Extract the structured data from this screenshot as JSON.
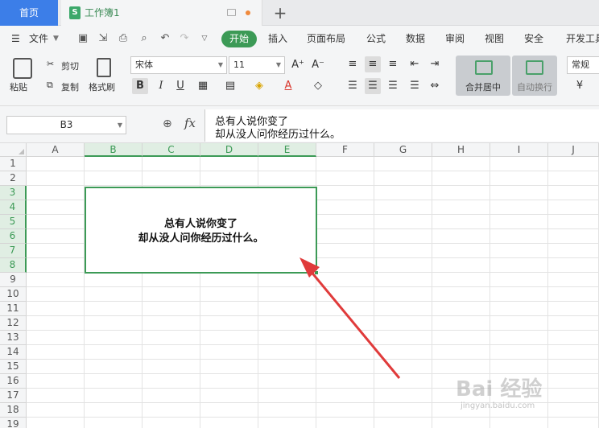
{
  "tabs": {
    "home": "首页",
    "document": "工作簿1",
    "doc_icon_letter": "S",
    "add": "+"
  },
  "menu": {
    "file": "文件",
    "items": [
      "开始",
      "插入",
      "页面布局",
      "公式",
      "数据",
      "审阅",
      "视图",
      "安全",
      "开发工具"
    ]
  },
  "ribbon": {
    "paste": "粘贴",
    "cut": "剪切",
    "copy": "复制",
    "format_painter": "格式刷",
    "font_name": "宋体",
    "font_size": "11",
    "merge_center": "合并居中",
    "wrap_text": "自动换行",
    "number_format": "常规",
    "currency_symbol": "¥"
  },
  "formula_bar": {
    "name_box": "B3",
    "fx": "fx",
    "content_line1": "总有人说你变了",
    "content_line2": "却从没人问你经历过什么。"
  },
  "grid": {
    "columns": [
      "A",
      "B",
      "C",
      "D",
      "E",
      "F",
      "G",
      "H",
      "I",
      "J"
    ],
    "rows": [
      "1",
      "2",
      "3",
      "4",
      "5",
      "6",
      "7",
      "8",
      "9",
      "10",
      "11",
      "12",
      "13",
      "14",
      "15",
      "16",
      "17",
      "18",
      "19"
    ],
    "merged_cell": {
      "range": "B3:E8",
      "line1": "总有人说你变了",
      "line2": "却从没人问你经历过什么。"
    }
  },
  "annotation": {
    "arrow_color": "#e03b3b"
  },
  "watermark": {
    "text": "Bai 经验",
    "sub": "jingyan.baidu.com"
  },
  "colors": {
    "accent": "#3c9a56",
    "home_tab": "#3c7ee8"
  }
}
